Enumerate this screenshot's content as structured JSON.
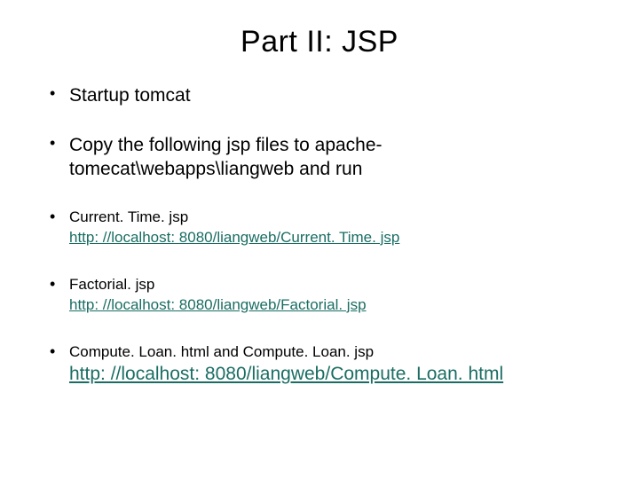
{
  "title": "Part II: JSP",
  "bullets": {
    "b1": "Startup tomcat",
    "b2": "Copy the following jsp files to apache-tomecat\\webapps\\liangweb and run",
    "b3_label": "Current. Time. jsp",
    "b3_link": "http: //localhost: 8080/liangweb/Current. Time. jsp",
    "b4_label": "Factorial. jsp",
    "b4_link": "http: //localhost: 8080/liangweb/Factorial. jsp",
    "b5_label": "Compute. Loan. html and Compute. Loan. jsp",
    "b5_link": "http: //localhost: 8080/liangweb/Compute. Loan. html"
  }
}
